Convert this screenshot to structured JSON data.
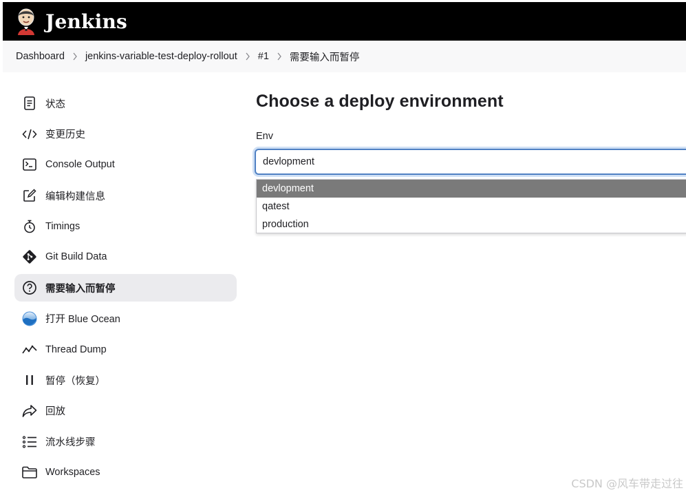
{
  "header": {
    "brand": "Jenkins"
  },
  "breadcrumb": [
    "Dashboard",
    "jenkins-variable-test-deploy-rollout",
    "#1",
    "需要输入而暂停"
  ],
  "sidebar": {
    "items": [
      {
        "label": "状态",
        "icon": "document-icon"
      },
      {
        "label": "变更历史",
        "icon": "code-icon"
      },
      {
        "label": "Console Output",
        "icon": "terminal-icon"
      },
      {
        "label": "编辑构建信息",
        "icon": "edit-icon"
      },
      {
        "label": "Timings",
        "icon": "stopwatch-icon"
      },
      {
        "label": "Git Build Data",
        "icon": "git-icon"
      },
      {
        "label": "需要输入而暂停",
        "icon": "help-circle-icon",
        "active": true
      },
      {
        "label": "打开 Blue Ocean",
        "icon": "blue-ocean-icon"
      },
      {
        "label": "Thread Dump",
        "icon": "pulse-icon"
      },
      {
        "label": "暂停（恢复）",
        "icon": "pause-icon"
      },
      {
        "label": "回放",
        "icon": "replay-arrow-icon"
      },
      {
        "label": "流水线步骤",
        "icon": "list-steps-icon"
      },
      {
        "label": "Workspaces",
        "icon": "folder-icon"
      }
    ]
  },
  "main": {
    "title": "Choose a deploy environment",
    "field_label": "Env",
    "selected_value": "devlopment",
    "options": [
      "devlopment",
      "qatest",
      "production"
    ]
  },
  "colors": {
    "header_bg": "#000000",
    "breadcrumb_bg": "#f8f8f9",
    "active_item_bg": "#ebebee",
    "focus_border": "#4f80c3",
    "option_highlight": "#7a7a7a"
  },
  "watermark": "CSDN @风车带走过往"
}
